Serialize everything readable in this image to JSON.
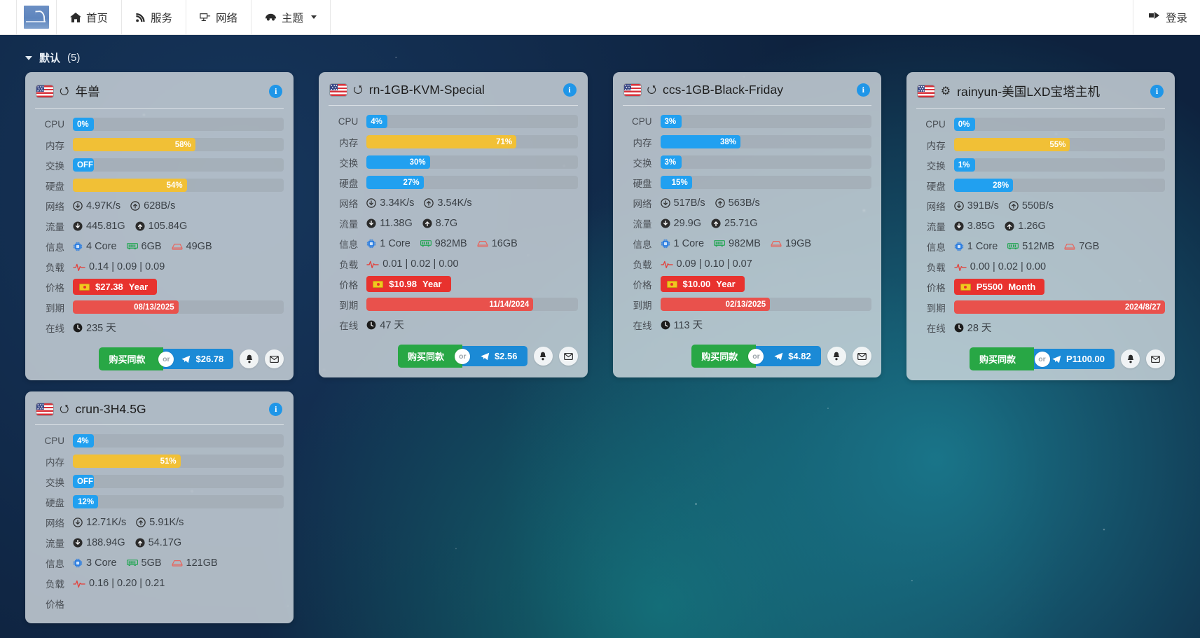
{
  "navbar": {
    "brand_name": "site-logo",
    "items": [
      {
        "icon": "home-icon",
        "glyph": "⌂",
        "label": "首页"
      },
      {
        "icon": "rss-icon",
        "glyph": "ᴘ",
        "label": "服务"
      },
      {
        "icon": "network-icon",
        "glyph": "⎓",
        "label": "网络"
      },
      {
        "icon": "theme-icon",
        "glyph": "☂",
        "label": "主题",
        "caret": true
      }
    ],
    "login": {
      "icon": "login-icon",
      "glyph": "→]",
      "label": "登录"
    }
  },
  "group": {
    "label": "默认",
    "count": "(5)"
  },
  "labels": {
    "cpu": "CPU",
    "mem": "内存",
    "swap": "交换",
    "disk": "硬盘",
    "net": "网络",
    "traffic": "流量",
    "info": "信息",
    "load": "负载",
    "price": "价格",
    "expire": "到期",
    "online": "在线"
  },
  "buttons": {
    "buy": "购买同款",
    "or": "or",
    "bell": "🔔",
    "mail": "✉"
  },
  "cards": [
    {
      "flag": "us-flag-icon",
      "os": "ubuntu-icon",
      "title": "年兽",
      "cpu": {
        "text": "0%",
        "pct": 6,
        "color": "b-blue",
        "align": "left"
      },
      "mem": {
        "text": "58%",
        "pct": 58,
        "color": "b-yellow",
        "align": "right"
      },
      "swap": {
        "text": "OFF",
        "pct": 7,
        "color": "b-blue",
        "align": "left"
      },
      "disk": {
        "text": "54%",
        "pct": 54,
        "color": "b-yellow",
        "align": "right"
      },
      "net_down": "4.97K/s",
      "net_up": "628B/s",
      "traffic_down": "445.81G",
      "traffic_up": "105.84G",
      "cores": "4 Core",
      "ram": "6GB",
      "storage": "49GB",
      "load": "0.14 | 0.09 | 0.09",
      "price": "$27.38",
      "price_unit": "Year",
      "expire": "08/13/2025",
      "expire_pct": 50,
      "online": "235 天",
      "pay_amount": "$26.78"
    },
    {
      "flag": "us-flag-icon",
      "os": "ubuntu-icon",
      "title": "rn-1GB-KVM-Special",
      "cpu": {
        "text": "4%",
        "pct": 7,
        "color": "b-blue",
        "align": "left"
      },
      "mem": {
        "text": "71%",
        "pct": 71,
        "color": "b-yellow",
        "align": "right"
      },
      "swap": {
        "text": "30%",
        "pct": 30,
        "color": "b-blue",
        "align": "right"
      },
      "disk": {
        "text": "27%",
        "pct": 27,
        "color": "b-blue",
        "align": "right"
      },
      "net_down": "3.34K/s",
      "net_up": "3.54K/s",
      "traffic_down": "11.38G",
      "traffic_up": "8.7G",
      "cores": "1 Core",
      "ram": "982MB",
      "storage": "16GB",
      "load": "0.01 | 0.02 | 0.00",
      "price": "$10.98",
      "price_unit": "Year",
      "expire": "11/14/2024",
      "expire_pct": 79,
      "online": "47 天",
      "pay_amount": "$2.56"
    },
    {
      "flag": "us-flag-icon",
      "os": "ubuntu-icon",
      "title": "ccs-1GB-Black-Friday",
      "cpu": {
        "text": "3%",
        "pct": 7,
        "color": "b-blue",
        "align": "left"
      },
      "mem": {
        "text": "38%",
        "pct": 38,
        "color": "b-blue",
        "align": "right"
      },
      "swap": {
        "text": "3%",
        "pct": 7,
        "color": "b-blue",
        "align": "left"
      },
      "disk": {
        "text": "15%",
        "pct": 15,
        "color": "b-blue",
        "align": "right"
      },
      "net_down": "517B/s",
      "net_up": "563B/s",
      "traffic_down": "29.9G",
      "traffic_up": "25.71G",
      "cores": "1 Core",
      "ram": "982MB",
      "storage": "19GB",
      "load": "0.09 | 0.10 | 0.07",
      "price": "$10.00",
      "price_unit": "Year",
      "expire": "02/13/2025",
      "expire_pct": 52,
      "online": "113 天",
      "pay_amount": "$4.82"
    },
    {
      "flag": "us-flag-icon",
      "os": "gear-icon",
      "title": "rainyun-美国LXD宝塔主机",
      "cpu": {
        "text": "0%",
        "pct": 6,
        "color": "b-blue",
        "align": "left"
      },
      "mem": {
        "text": "55%",
        "pct": 55,
        "color": "b-yellow",
        "align": "right"
      },
      "swap": {
        "text": "1%",
        "pct": 6,
        "color": "b-blue",
        "align": "left"
      },
      "disk": {
        "text": "28%",
        "pct": 28,
        "color": "b-blue",
        "align": "right"
      },
      "net_down": "391B/s",
      "net_up": "550B/s",
      "traffic_down": "3.85G",
      "traffic_up": "1.26G",
      "cores": "1 Core",
      "ram": "512MB",
      "storage": "7GB",
      "load": "0.00 | 0.02 | 0.00",
      "price": "P5500",
      "price_unit": "Month",
      "expire": "2024/8/27",
      "expire_pct": 100,
      "online": "28 天",
      "pay_amount": "P1100.00"
    },
    {
      "flag": "us-flag-icon",
      "os": "ubuntu-icon",
      "title": "crun-3H4.5G",
      "cpu": {
        "text": "4%",
        "pct": 7,
        "color": "b-blue",
        "align": "left"
      },
      "mem": {
        "text": "51%",
        "pct": 51,
        "color": "b-yellow",
        "align": "right"
      },
      "swap": {
        "text": "OFF",
        "pct": 7,
        "color": "b-blue",
        "align": "left"
      },
      "disk": {
        "text": "12%",
        "pct": 12,
        "color": "b-blue",
        "align": "right"
      },
      "net_down": "12.71K/s",
      "net_up": "5.91K/s",
      "traffic_down": "188.94G",
      "traffic_up": "54.17G",
      "cores": "3 Core",
      "ram": "5GB",
      "storage": "121GB",
      "load": "0.16 | 0.20 | 0.21",
      "price": "",
      "price_unit": "",
      "expire": "",
      "expire_pct": 0,
      "online": "",
      "pay_amount": ""
    }
  ]
}
